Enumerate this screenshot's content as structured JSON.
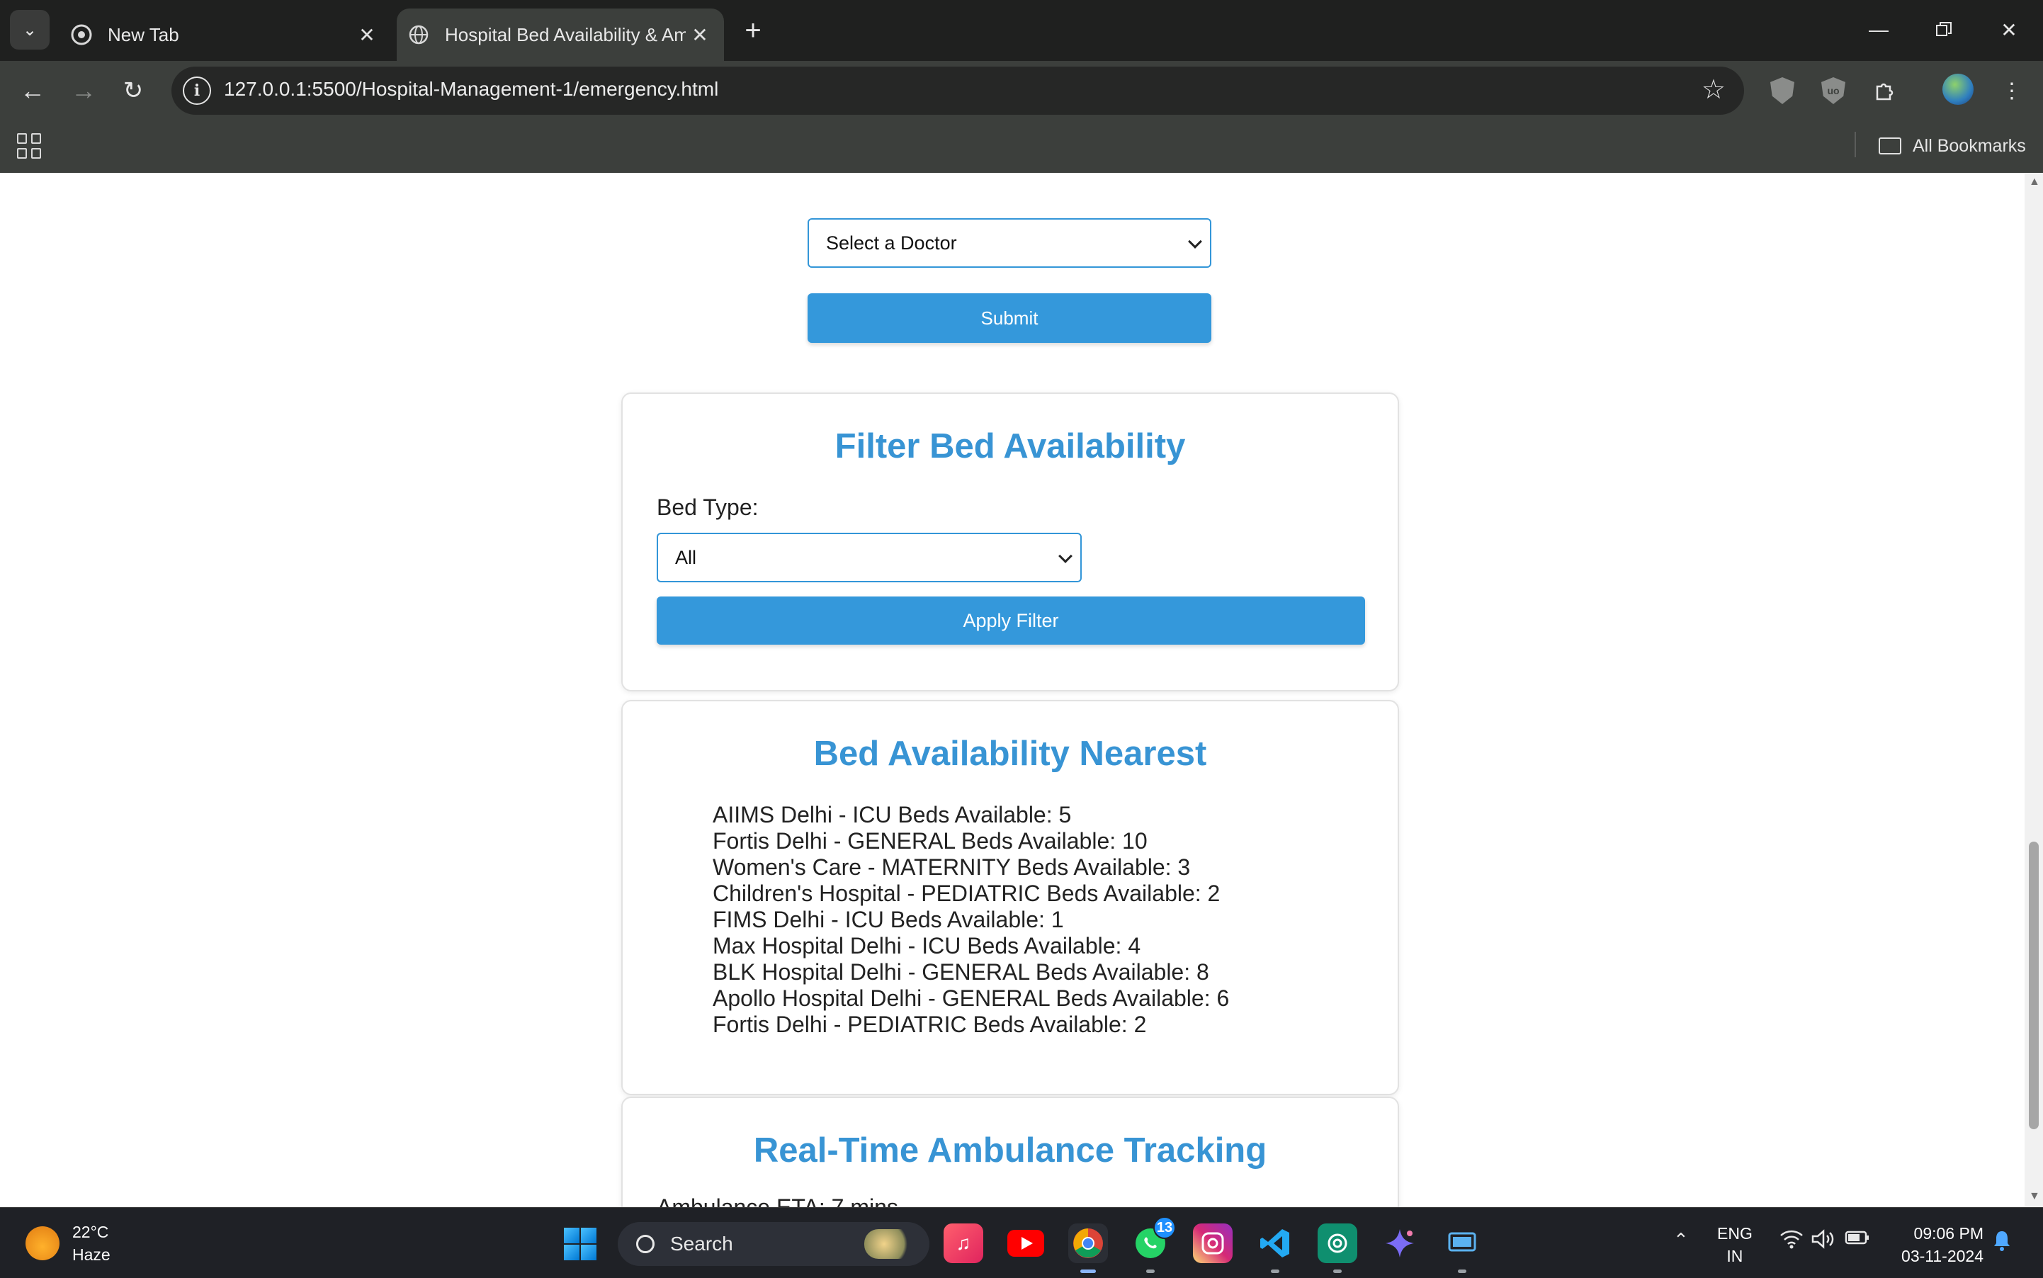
{
  "browser": {
    "tabs": [
      {
        "title": "New Tab",
        "active": false
      },
      {
        "title": "Hospital Bed Availability & Amb",
        "active": true
      }
    ],
    "url": "127.0.0.1:5500/Hospital-Management-1/emergency.html",
    "bookmarks_label": "All Bookmarks"
  },
  "page": {
    "doctor_select": {
      "value": "Select a Doctor"
    },
    "submit_label": "Submit",
    "filter": {
      "title": "Filter Bed Availability",
      "bed_type_label": "Bed Type:",
      "bed_type_value": "All",
      "apply_label": "Apply Filter"
    },
    "nearest": {
      "title": "Bed Availability Nearest",
      "items": [
        "AIIMS Delhi - ICU Beds Available: 5",
        "Fortis Delhi - GENERAL Beds Available: 10",
        "Women's Care - MATERNITY Beds Available: 3",
        "Children's Hospital - PEDIATRIC Beds Available: 2",
        "FIMS Delhi - ICU Beds Available: 1",
        "Max Hospital Delhi - ICU Beds Available: 4",
        "BLK Hospital Delhi - GENERAL Beds Available: 8",
        "Apollo Hospital Delhi - GENERAL Beds Available: 6",
        "Fortis Delhi - PEDIATRIC Beds Available: 2"
      ]
    },
    "ambulance": {
      "title": "Real-Time Ambulance Tracking",
      "eta": "Ambulance ETA: 7 mins"
    }
  },
  "taskbar": {
    "weather_temp": "22°C",
    "weather_desc": "Haze",
    "search_label": "Search",
    "whatsapp_badge": "13",
    "lang_line1": "ENG",
    "lang_line2": "IN",
    "time": "09:06 PM",
    "date": "03-11-2024"
  },
  "colors": {
    "accent": "#3498db",
    "heading": "#3894d4",
    "chrome_bg": "#3c3f3c",
    "taskbar_bg": "#1f2126"
  }
}
